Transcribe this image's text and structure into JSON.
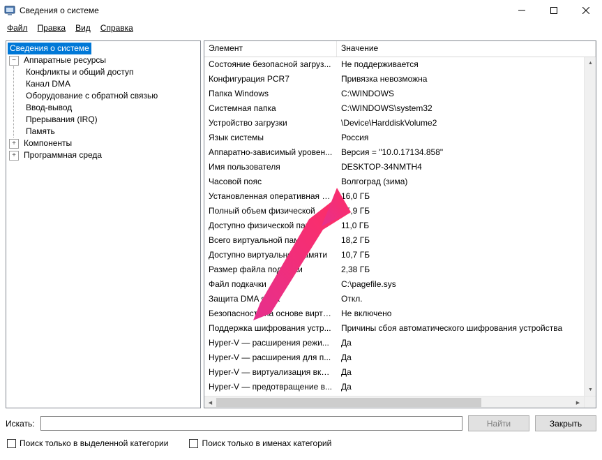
{
  "window": {
    "title": "Сведения о системе"
  },
  "menu": {
    "file": "Файл",
    "edit": "Правка",
    "view": "Вид",
    "help": "Справка"
  },
  "tree": {
    "root": "Сведения о системе",
    "hw": "Аппаратные ресурсы",
    "hw_items": {
      "conflicts": "Конфликты и общий доступ",
      "dma": "Канал DMA",
      "forcedhw": "Оборудование с обратной связью",
      "io": "Ввод-вывод",
      "irq": "Прерывания (IRQ)",
      "memory": "Память"
    },
    "components": "Компоненты",
    "swenv": "Программная среда"
  },
  "list": {
    "col_element": "Элемент",
    "col_value": "Значение",
    "rows": [
      {
        "el": "Состояние безопасной загруз...",
        "val": "Не поддерживается"
      },
      {
        "el": "Конфигурация PCR7",
        "val": "Привязка невозможна"
      },
      {
        "el": "Папка Windows",
        "val": "C:\\WINDOWS"
      },
      {
        "el": "Системная папка",
        "val": "C:\\WINDOWS\\system32"
      },
      {
        "el": "Устройство загрузки",
        "val": "\\Device\\HarddiskVolume2"
      },
      {
        "el": "Язык системы",
        "val": "Россия"
      },
      {
        "el": "Аппаратно-зависимый уровен...",
        "val": "Версия = \"10.0.17134.858\""
      },
      {
        "el": "Имя пользователя",
        "val": "DESKTOP-34NMTH4"
      },
      {
        "el": "Часовой пояс",
        "val": "Волгоград (зима)"
      },
      {
        "el": "Установленная оперативная п...",
        "val": "16,0 ГБ"
      },
      {
        "el": "Полный объем физической ... ",
        "val": "15,9 ГБ"
      },
      {
        "el": "Доступно физической памяти",
        "val": "11,0 ГБ"
      },
      {
        "el": "Всего виртуальной памяти",
        "val": "18,2 ГБ"
      },
      {
        "el": "Доступно виртуальной памяти",
        "val": "10,7 ГБ"
      },
      {
        "el": "Размер файла подкачки",
        "val": "2,38 ГБ"
      },
      {
        "el": "Файл подкачки",
        "val": "C:\\pagefile.sys"
      },
      {
        "el": "Защита DMA ядра",
        "val": "Откл."
      },
      {
        "el": "Безопасность на основе вирту...",
        "val": "Не включено"
      },
      {
        "el": "Поддержка шифрования устр...",
        "val": "Причины сбоя автоматического шифрования устройства"
      },
      {
        "el": "Hyper-V — расширения режи...",
        "val": "Да"
      },
      {
        "el": "Hyper-V — расширения для п...",
        "val": "Да"
      },
      {
        "el": "Hyper-V — виртуализация вкл...",
        "val": "Да"
      },
      {
        "el": "Hyper-V — предотвращение в...",
        "val": "Да"
      }
    ]
  },
  "search": {
    "label": "Искать:",
    "find_btn": "Найти",
    "close_btn": "Закрыть",
    "chk_selected": "Поиск только в выделенной категории",
    "chk_names": "Поиск только в именах категорий"
  }
}
